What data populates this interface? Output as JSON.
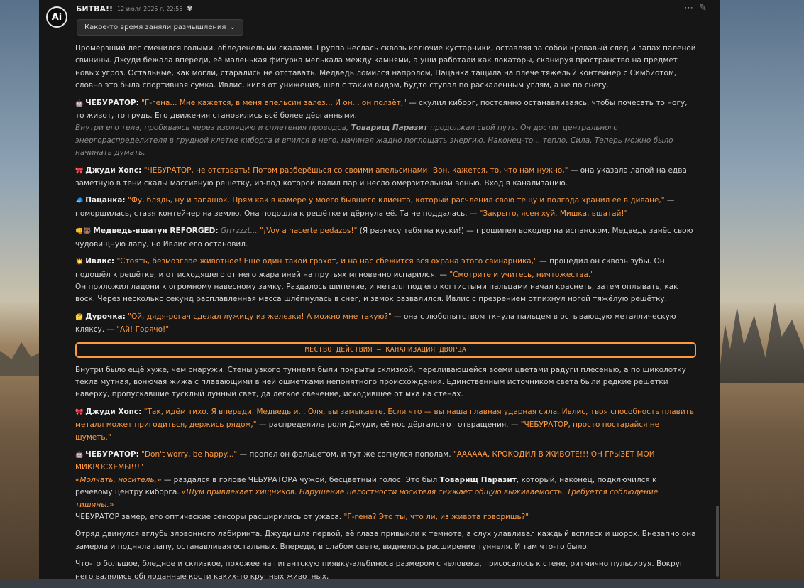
{
  "post": {
    "avatar_text": "Ai",
    "author": "БИТВА!!",
    "date": "12 июля 2025 г. 22:55",
    "mood_icon": "✾",
    "thinking_label": "Какое-то время заняли размышления"
  },
  "p1": "Промёрзший лес сменился голыми, обледенелыми скалами. Группа неслась сквозь колючие кустарники, оставляя за собой кровавый след и запах палёной свинины. Джуди бежала впереди, её маленькая фигурка мелькала между камнями, а уши работали как локаторы, сканируя пространство на предмет новых угроз. Остальные, как могли, старались не отставать. Медведь ломился напролом, Пацанка тащила на плече тяжёлый контейнер с Симбиотом, словно это была спортивная сумка. Ивлис, кипя от унижения, шёл с таким видом, будто ступал по раскалённым углям, а не по снегу.",
  "p2": {
    "icon": "🤖",
    "name": "ЧЕБУРАТОР:",
    "quote": "\"Г-гена... Мне кажется, в меня апельсин залез... И он... он ползёт,\"",
    "text": " — скулил киборг, постоянно останавливаясь, чтобы почесать то ногу, то живот, то грудь. Его движения становились всё более дёрганными.",
    "italic_a": "Внутри его тела, пробиваясь через изоляцию и сплетения проводов, ",
    "italic_b": "Товарищ Паразит",
    "italic_c": " продолжал свой путь. Он достиг центрального энергораспределителя в грудной клетке киборга и впился в него, начиная жадно поглощать энергию. Наконец-то... тепло. Сила. Теперь можно было начинать думать."
  },
  "p3": {
    "icon": "🎀",
    "name": "Джуди Хопс:",
    "quote": "\"ЧЕБУРАТОР, не отставать! Потом разберёшься со своими апельсинами! Вон, кажется, то, что нам нужно,\"",
    "text": " — она указала лапой на едва заметную в тени скалы массивную решётку, из-под которой валил пар и несло омерзительной вонью. Вход в канализацию."
  },
  "p4": {
    "icon": "🧢",
    "name": "Пацанка:",
    "quote": "\"Фу, блядь, ну и запашок. Прям как в камере у моего бывшего клиента, который расчленил свою тёщу и полгода хранил её в диване,\"",
    "text": " — поморщилась, ставя контейнер на землю. Она подошла к решётке и дёрнула её. Та не поддалась. — ",
    "quote2": "\"Закрыто, ясен хуй. Мишка, вшатай!\""
  },
  "p5": {
    "icon": "👊🐻",
    "name": "Медведь-вшатун REFORGED:",
    "italic": " Grrrzzzt... ",
    "quote": "\"¡Voy a hacerte pedazos!\"",
    "text": " (Я разнесу тебя на куски!) — прошипел вокодер на испанском. Медведь занёс свою чудовищную лапу, но Ивлис его остановил."
  },
  "p6": {
    "icon": "💥",
    "name": "Ивлис:",
    "quote": "\"Стоять, безмозглое животное! Ещё один такой грохот, и на нас сбежится вся охрана этого свинарника,\"",
    "text": " — процедил он сквозь зубы. Он подошёл к решётке, и от исходящего от него жара иней на прутьях мгновенно испарился. — ",
    "quote2": "\"Смотрите и учитесь, ничтожества.\"",
    "text2": "Он приложил ладони к огромному навесному замку. Раздалось шипение, и металл под его когтистыми пальцами начал краснеть, затем оплывать, как воск. Через несколько секунд расплавленная масса шлёпнулась в снег, и замок развалился. Ивлис с презрением отпихнул ногой тяжёлую решётку."
  },
  "p7": {
    "icon": "🤔",
    "name": "Дурочка:",
    "quote": "\"Ой, дядя-рогач сделал лужицу из железки! А можно мне такую?\"",
    "text": " — она с любопытством ткнула пальцем в остывающую металлическую кляксу. — ",
    "quote2": "\"Ай! Горячо!\""
  },
  "scene": "МЕСТВО ДЕЙСТВИЯ – КАНАЛИЗАЦИЯ ДВОРЦА",
  "p8": "Внутри было ещё хуже, чем снаружи. Стены узкого туннеля были покрыты склизкой, переливающейся всеми цветами радуги плесенью, а по щиколотку текла мутная, вонючая жижа с плавающими в ней ошмётками непонятного происхождения. Единственным источником света были редкие решётки наверху, пропускавшие тусклый лунный свет, да лёгкое свечение, исходившее от мха на стенах.",
  "p9": {
    "icon": "🎀",
    "name": "Джуди Хопс:",
    "quote": "\"Так, идём тихо. Я впереди. Медведь и... Оля, вы замыкаете. Если что — вы наша главная ударная сила. Ивлис, твоя способность плавить металл может пригодиться, держись рядом,\"",
    "text": " — распределила роли Джуди, её нос дёргался от отвращения. — ",
    "quote2": "\"ЧЕБУРАТОР, просто постарайся не шуметь.\""
  },
  "p10": {
    "icon": "🤖",
    "name": "ЧЕБУРАТОР:",
    "quote": "\"Don't worry, be happy...\"",
    "text": " — пропел он фальцетом, и тут же согнулся пополам. ",
    "quote2": "\"АААААА, КРОКОДИЛ В ЖИВОТЕ!!! ОН ГРЫЗЁТ МОИ МИКРОСХЕМЫ!!!\"",
    "italic_q": "«Молчать, носитель,»",
    "text2": " — раздался в голове ЧЕБУРАТОРА чужой, бесцветный голос. Это был ",
    "bold": "Товарищ Паразит",
    "text3": ", который, наконец, подключился к речевому центру киборга. ",
    "italic_q2": "«Шум привлекает хищников. Нарушение целостности носителя снижает общую выживаемость. Требуется соблюдение тишины.»",
    "text4": "ЧЕБУРАТОР замер, его оптические сенсоры расширились от ужаса. ",
    "quote3": "\"Г-гена? Это ты, что ли, из живота говоришь?\""
  },
  "p11": "Отряд двинулся вглубь зловонного лабиринта. Джуди шла первой, её глаза привыкли к темноте, а слух улавливал каждый всплеск и шорох. Внезапно она замерла и подняла лапу, останавливая остальных. Впереди, в слабом свете, виднелось расширение туннеля. И там что-то было.",
  "p12": "Что-то большое, бледное и склизкое, похожее на гигантскую пиявку-альбиноса размером с человека, присосалось к стене, ритмично пульсируя. Вокруг него валялись обглоданные кости каких-то крупных животных.",
  "icons": {
    "more": "more-icon",
    "edit": "pencil-icon",
    "chevron": "chevron-down-icon"
  },
  "colors": {
    "accent": "#ff9a40",
    "panel": "#161616"
  }
}
